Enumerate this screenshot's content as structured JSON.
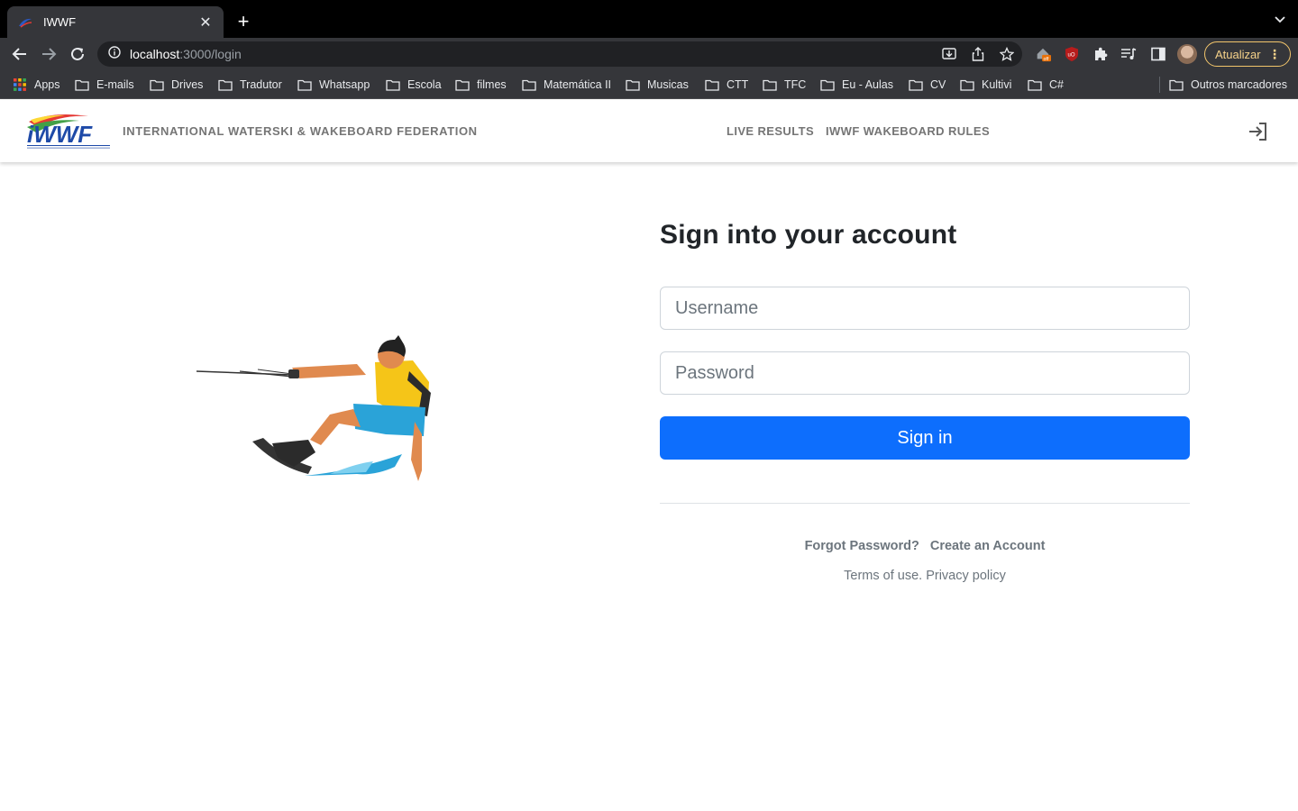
{
  "browser": {
    "tab": {
      "title": "IWWF"
    },
    "url": {
      "host": "localhost",
      "path": ":3000/login"
    },
    "update_label": "Atualizar",
    "extension_badge": "off",
    "bookmarks": [
      {
        "label": "Apps",
        "icon": "apps-grid-icon"
      },
      {
        "label": "E-mails",
        "icon": "folder-icon"
      },
      {
        "label": "Drives",
        "icon": "folder-icon"
      },
      {
        "label": "Tradutor",
        "icon": "folder-icon"
      },
      {
        "label": "Whatsapp",
        "icon": "folder-icon"
      },
      {
        "label": "Escola",
        "icon": "folder-icon"
      },
      {
        "label": "filmes",
        "icon": "folder-icon"
      },
      {
        "label": "Matemática II",
        "icon": "folder-icon"
      },
      {
        "label": "Musicas",
        "icon": "folder-icon"
      },
      {
        "label": "CTT",
        "icon": "folder-icon"
      },
      {
        "label": "TFC",
        "icon": "folder-icon"
      },
      {
        "label": "Eu - Aulas",
        "icon": "folder-icon"
      },
      {
        "label": "CV",
        "icon": "folder-icon"
      },
      {
        "label": "Kultivi",
        "icon": "folder-icon"
      },
      {
        "label": "C#",
        "icon": "folder-icon"
      }
    ],
    "other_bookmarks": "Outros marcadores"
  },
  "header": {
    "brand": "INTERNATIONAL WATERSKI & WAKEBOARD FEDERATION",
    "nav": [
      {
        "label": "LIVE RESULTS"
      },
      {
        "label": "IWWF WAKEBOARD RULES"
      }
    ]
  },
  "login": {
    "heading": "Sign into your account",
    "username_placeholder": "Username",
    "password_placeholder": "Password",
    "submit_label": "Sign in",
    "forgot_label": "Forgot Password?",
    "create_label": "Create an Account",
    "terms_label": "Terms of use.",
    "privacy_label": "Privacy policy"
  },
  "colors": {
    "primary": "#0d6efd",
    "muted": "#6c757d",
    "update_accent": "#f2c56b"
  }
}
